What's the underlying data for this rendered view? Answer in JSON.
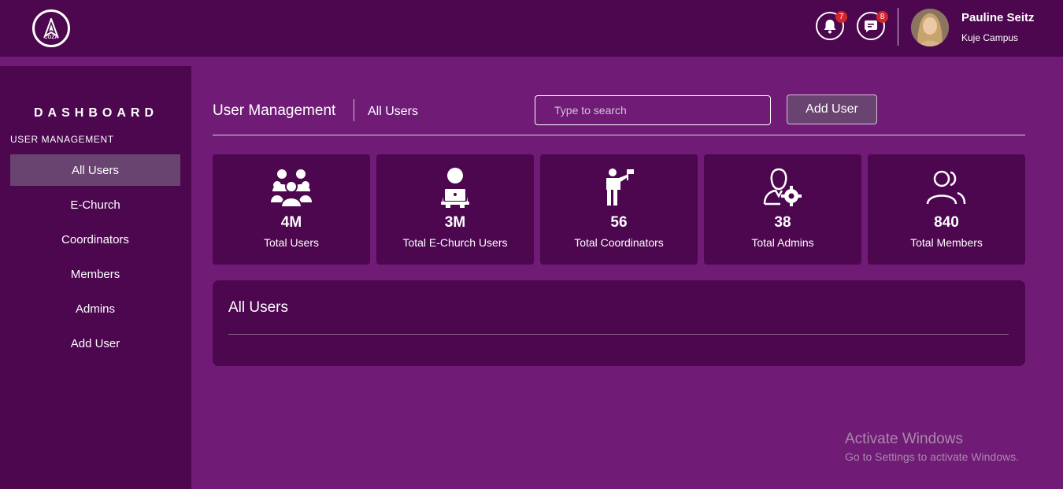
{
  "header": {
    "logo_text": "COZA",
    "notifications_count": "7",
    "messages_count": "8",
    "user_name": "Pauline Seitz",
    "user_campus": "Kuje Campus"
  },
  "sidebar": {
    "title": "DASHBOARD",
    "section": "USER MANAGEMENT",
    "items": [
      {
        "label": "All Users",
        "active": true
      },
      {
        "label": "E-Church"
      },
      {
        "label": "Coordinators"
      },
      {
        "label": "Members"
      },
      {
        "label": "Admins"
      },
      {
        "label": "Add User"
      }
    ]
  },
  "main": {
    "title": "User Management",
    "subtitle": "All Users",
    "search_placeholder": "Type to search",
    "add_button": "Add User"
  },
  "stats": [
    {
      "icon": "users-group-icon",
      "value": "4M",
      "label": "Total Users"
    },
    {
      "icon": "laptop-user-icon",
      "value": "3M",
      "label": "Total E-Church Users"
    },
    {
      "icon": "person-flag-icon",
      "value": "56",
      "label": "Total Coordinators"
    },
    {
      "icon": "user-gear-icon",
      "value": "38",
      "label": "Total Admins"
    },
    {
      "icon": "users-outline-icon",
      "value": "840",
      "label": "Total Members"
    }
  ],
  "panel": {
    "title": "All Users"
  },
  "watermark": {
    "line1": "Activate Windows",
    "line2": "Go to Settings to activate Windows."
  },
  "colors": {
    "background": "#701b76",
    "panel": "#4c074f",
    "active_item": "#6a4470",
    "badge": "#d3262a"
  }
}
